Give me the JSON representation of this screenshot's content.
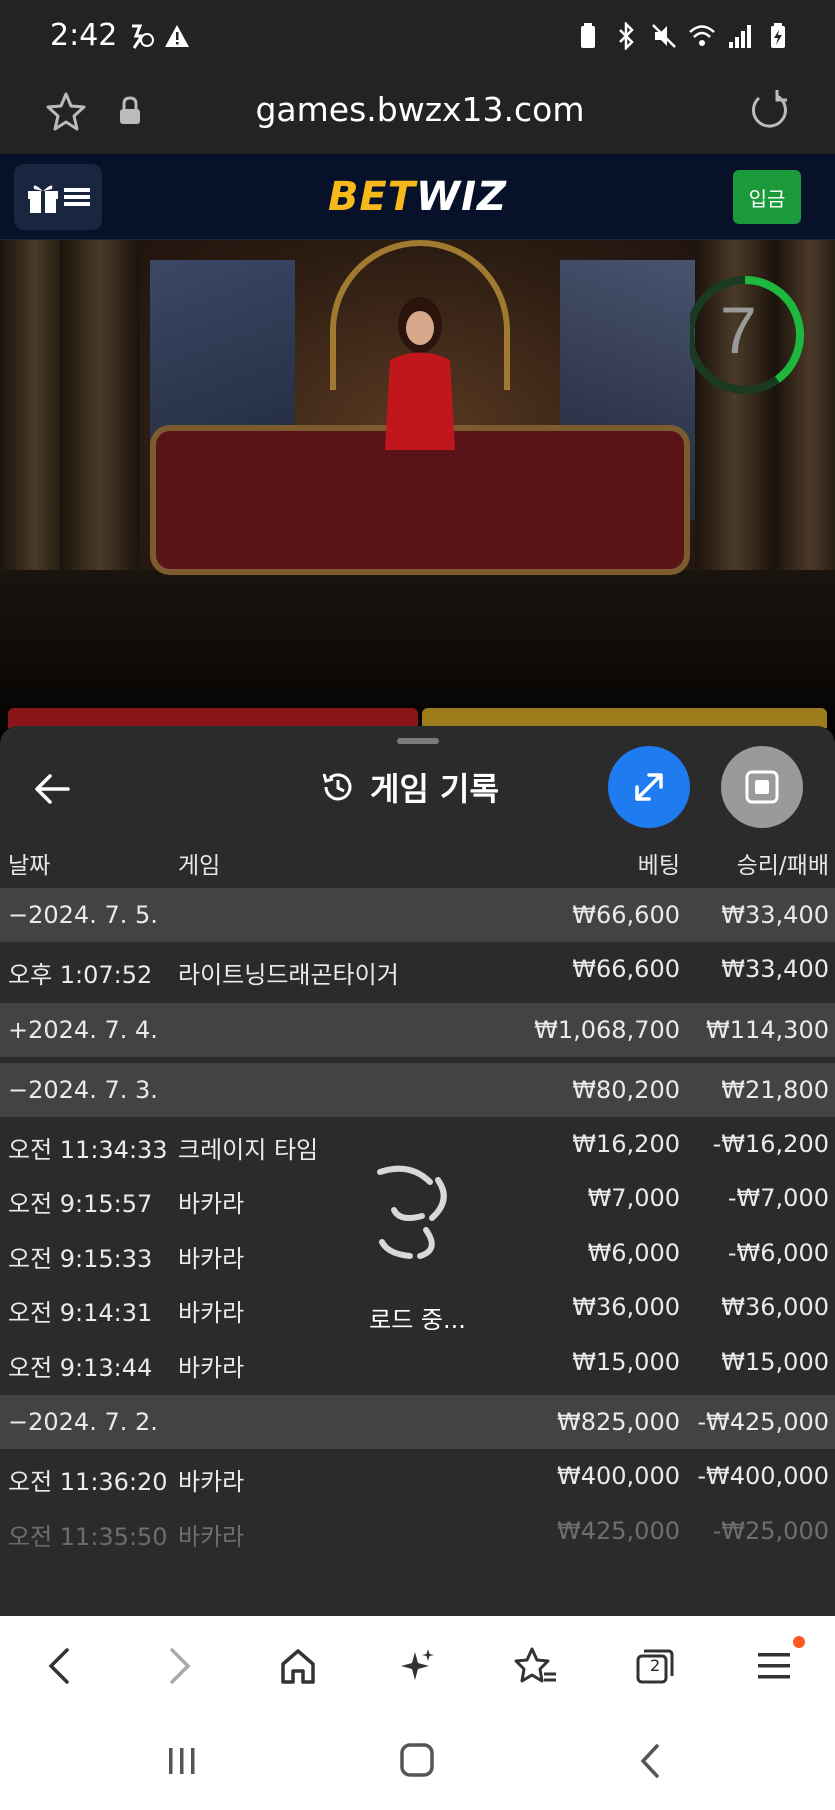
{
  "status": {
    "time": "2:42"
  },
  "browser": {
    "url": "games.bwzx13.com",
    "tabs_count": "2"
  },
  "site": {
    "logo_bet": "BET",
    "logo_wiz": "WIZ",
    "deposit_label": "입금"
  },
  "video": {
    "timer_value": "7",
    "timer_progress": 0.4
  },
  "history": {
    "title": "게임 기록",
    "columns": {
      "date": "날짜",
      "game": "게임",
      "bet": "베팅",
      "result": "승리/패배"
    },
    "rows": [
      {
        "type": "date",
        "date": "−2024. 7. 5.",
        "game": "",
        "bet": "₩66,600",
        "result": "₩33,400"
      },
      {
        "type": "detail",
        "date": "오후 1:07:52",
        "game": "라이트닝드래곤타이거",
        "bet": "₩66,600",
        "result": "₩33,400"
      },
      {
        "type": "date",
        "date": "+2024. 7. 4.",
        "game": "",
        "bet": "₩1,068,700",
        "result": "₩114,300"
      },
      {
        "type": "date",
        "date": "−2024. 7. 3.",
        "game": "",
        "bet": "₩80,200",
        "result": "₩21,800"
      },
      {
        "type": "detail",
        "date": "오전 11:34:33",
        "game": "크레이지 타임",
        "bet": "₩16,200",
        "result": "-₩16,200"
      },
      {
        "type": "detail",
        "date": "오전 9:15:57",
        "game": "바카라",
        "bet": "₩7,000",
        "result": "-₩7,000"
      },
      {
        "type": "detail",
        "date": "오전 9:15:33",
        "game": "바카라",
        "bet": "₩6,000",
        "result": "-₩6,000"
      },
      {
        "type": "detail",
        "date": "오전 9:14:31",
        "game": "바카라",
        "bet": "₩36,000",
        "result": "₩36,000"
      },
      {
        "type": "detail",
        "date": "오전 9:13:44",
        "game": "바카라",
        "bet": "₩15,000",
        "result": "₩15,000"
      },
      {
        "type": "date",
        "date": "−2024. 7. 2.",
        "game": "",
        "bet": "₩825,000",
        "result": "-₩425,000"
      },
      {
        "type": "detail",
        "date": "오전 11:36:20",
        "game": "바카라",
        "bet": "₩400,000",
        "result": "-₩400,000"
      },
      {
        "type": "detail",
        "date": "오전 11:35:50",
        "game": "바카라",
        "bet": "₩425,000",
        "result": "-₩25,000"
      }
    ],
    "loading_text": "로드 중..."
  },
  "colors": {
    "accent_blue": "#1e7cf0",
    "deposit_green": "#1a9a3a",
    "logo_gold": "#f6b81a",
    "header_bg": "#07122a"
  }
}
